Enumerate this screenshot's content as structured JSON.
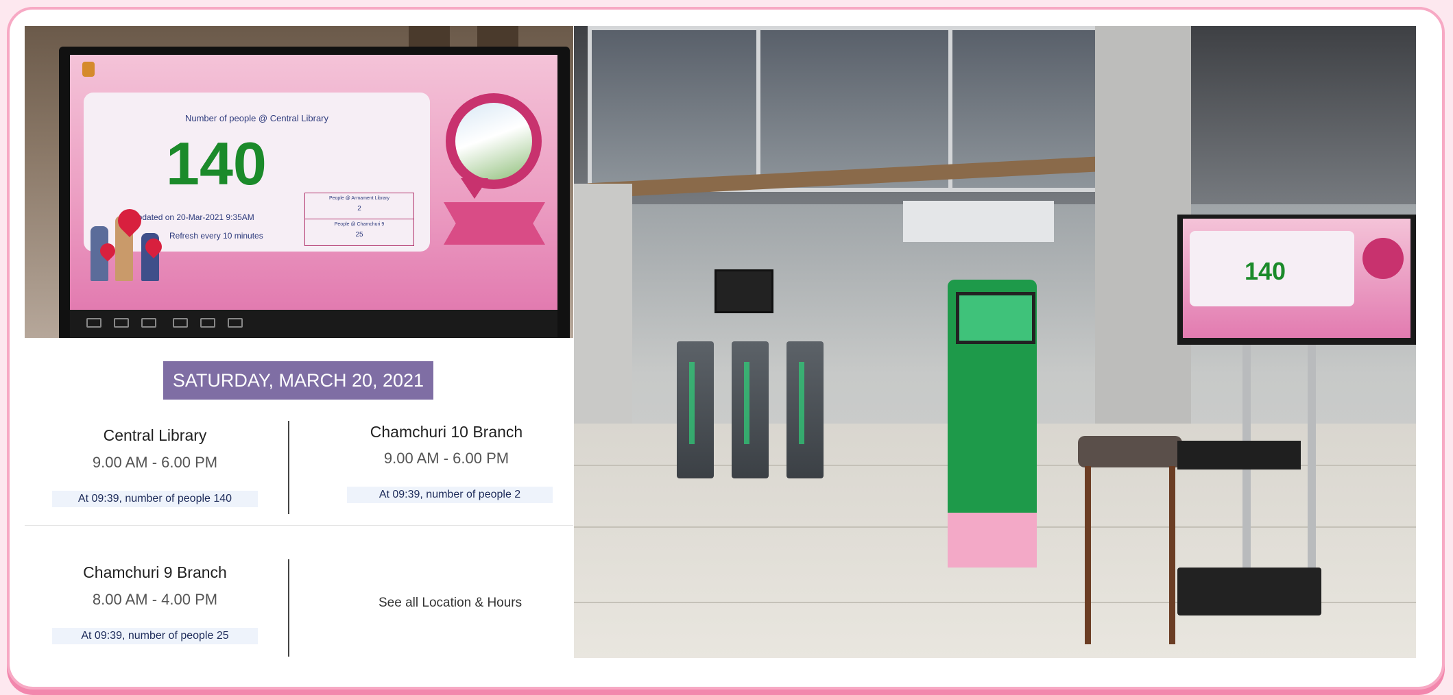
{
  "display": {
    "heading": "Number of people @ Central Library",
    "count": "140",
    "updated": "Updated on 20-Mar-2021 9:35AM",
    "refresh": "Refresh every 10 minutes",
    "table": [
      {
        "label": "People @ Armament Library",
        "value": "2"
      },
      {
        "label": "People @ Chamchuri 9",
        "value": "25"
      }
    ]
  },
  "hours": {
    "date": "SATURDAY, MARCH 20, 2021",
    "locations": [
      {
        "name": "Central Library",
        "time": "9.00 AM - 6.00 PM",
        "count": "At 09:39, number of people 140"
      },
      {
        "name": "Chamchuri 10 Branch",
        "time": "9.00 AM - 6.00 PM",
        "count": "At 09:39, number of people 2"
      },
      {
        "name": "Chamchuri 9 Branch",
        "time": "8.00 AM - 4.00 PM",
        "count": "At 09:39, number of people 25"
      }
    ],
    "see_all": "See all Location & Hours"
  },
  "lobby_tv": {
    "count": "140"
  },
  "colors": {
    "accent_green": "#1b8a2a",
    "banner_purple": "#7f6ea4",
    "frame_pink": "#f7a9c4"
  }
}
